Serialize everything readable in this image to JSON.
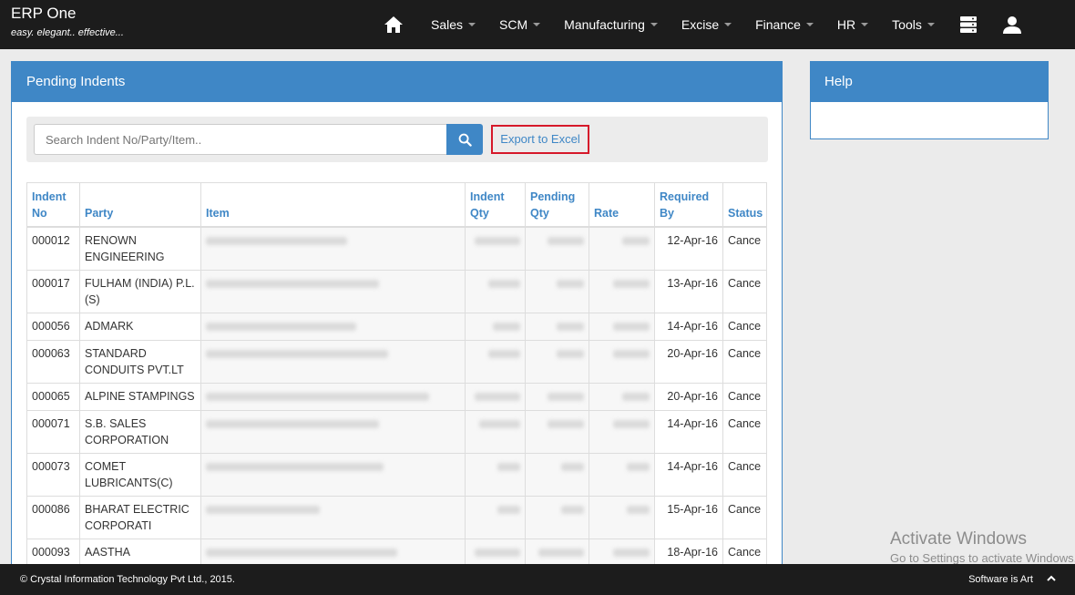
{
  "brand": {
    "title": "ERP One",
    "tagline": "easy. elegant.. effective..."
  },
  "nav": {
    "items": [
      {
        "label": "Sales"
      },
      {
        "label": "SCM"
      },
      {
        "label": "Manufacturing"
      },
      {
        "label": "Excise"
      },
      {
        "label": "Finance"
      },
      {
        "label": "HR"
      },
      {
        "label": "Tools"
      }
    ],
    "icons": [
      "home-icon",
      "server-icon",
      "user-icon"
    ]
  },
  "main": {
    "title": "Pending Indents",
    "search": {
      "placeholder": "Search Indent No/Party/Item..",
      "value": ""
    },
    "export_label": "Export to Excel",
    "table": {
      "headers": {
        "indent_no": "Indent No",
        "party": "Party",
        "item": "Item",
        "indent_qty": "Indent Qty",
        "pending_qty": "Pending Qty",
        "rate": "Rate",
        "required_by": "Required By",
        "status": "Status"
      },
      "rows": [
        {
          "indent_no": "000012",
          "party": "RENOWN ENGINEERING",
          "required_by": "12-Apr-16",
          "status": "Cance"
        },
        {
          "indent_no": "000017",
          "party": "FULHAM (INDIA) P.L. (S)",
          "required_by": "13-Apr-16",
          "status": "Cance"
        },
        {
          "indent_no": "000056",
          "party": "ADMARK",
          "required_by": "14-Apr-16",
          "status": "Cance"
        },
        {
          "indent_no": "000063",
          "party": "STANDARD CONDUITS PVT.LT",
          "required_by": "20-Apr-16",
          "status": "Cance"
        },
        {
          "indent_no": "000065",
          "party": "ALPINE STAMPINGS",
          "required_by": "20-Apr-16",
          "status": "Cance"
        },
        {
          "indent_no": "000071",
          "party": "S.B. SALES CORPORATION",
          "required_by": "14-Apr-16",
          "status": "Cance"
        },
        {
          "indent_no": "000073",
          "party": "COMET LUBRICANTS(C)",
          "required_by": "14-Apr-16",
          "status": "Cance"
        },
        {
          "indent_no": "000086",
          "party": "BHARAT ELECTRIC CORPORATI",
          "required_by": "15-Apr-16",
          "status": "Cance"
        },
        {
          "indent_no": "000093",
          "party": "AASTHA",
          "required_by": "18-Apr-16",
          "status": "Cance"
        }
      ]
    }
  },
  "help": {
    "title": "Help"
  },
  "watermark": {
    "title": "Activate Windows",
    "subtitle": "Go to Settings to activate Windows."
  },
  "footer": {
    "copyright": "© Crystal Information Technology Pvt Ltd., 2015.",
    "slogan": "Software is Art"
  },
  "colors": {
    "accent": "#3f87c6",
    "topbar": "#1c1c1c",
    "highlight": "#d6192a"
  }
}
